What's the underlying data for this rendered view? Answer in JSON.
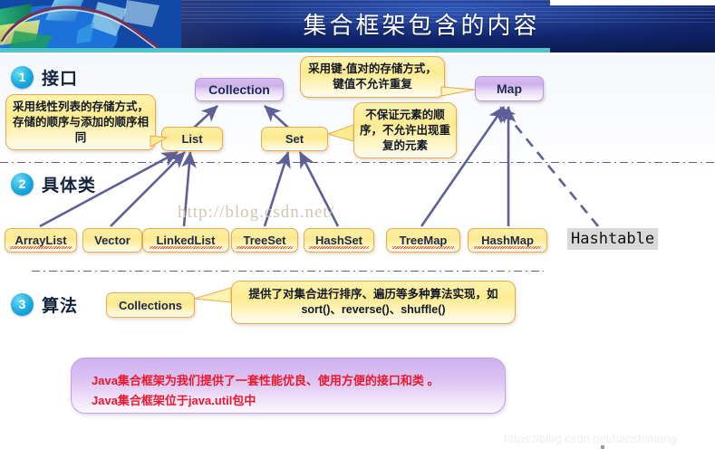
{
  "header": {
    "title": "集合框架包含的内容",
    "art_icon": "abstract-blue-graphic"
  },
  "sections": [
    {
      "num": "1",
      "label": "接口"
    },
    {
      "num": "2",
      "label": "具体类"
    },
    {
      "num": "3",
      "label": "算法"
    }
  ],
  "interfaces": [
    {
      "label": "Collection",
      "style": "purple"
    },
    {
      "label": "Map",
      "style": "purple"
    },
    {
      "label": "List",
      "style": "yellow"
    },
    {
      "label": "Set",
      "style": "yellow"
    }
  ],
  "classes": [
    {
      "label": "ArrayList"
    },
    {
      "label": "Vector"
    },
    {
      "label": "LinkedList"
    },
    {
      "label": "TreeSet"
    },
    {
      "label": "HashSet"
    },
    {
      "label": "TreeMap"
    },
    {
      "label": "HashMap"
    }
  ],
  "hashtable": {
    "label": "Hashtable"
  },
  "algorithm": {
    "node_label": "Collections",
    "callout": "提供了对集合进行排序、遍历等多种算法实现，如 sort()、reverse()、shuffle()"
  },
  "callouts": {
    "list": "采用线性列表的存储方式，存储的顺序与添加的顺序相同",
    "map": "采用键-值对的存储方式，键值不允许重复",
    "set": "不保证元素的顺序，不允许出现重复的元素"
  },
  "summary": {
    "line1": "Java集合框架为我们提供了一套性能优良、使用方便的接口和类 。",
    "line2": "Java集合框架位于java.util包中"
  },
  "watermarks": {
    "middle": "http://blog.csdn.net/",
    "footer": "https://blog.csdn.net/hanshimeng"
  },
  "colors": {
    "header_blue": "#12266e",
    "teal_bar": "#4fc3cb",
    "node_purple": "#cdb0ea",
    "node_yellow": "#fbe98e",
    "accent_orange": "#e8a94f",
    "arrow_purple": "#5e5f96",
    "summary_red": "#e8192c",
    "circle_cyan": "#17a9dd"
  }
}
